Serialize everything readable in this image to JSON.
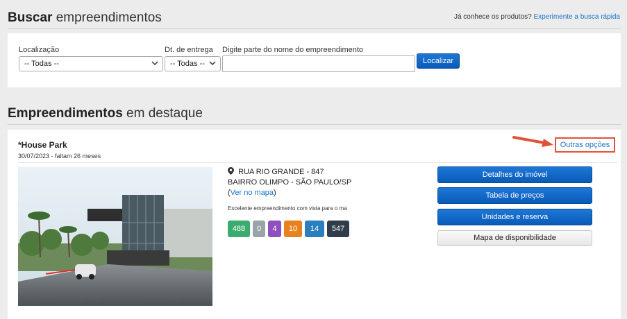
{
  "search": {
    "title_bold": "Buscar",
    "title_rest": "empreendimentos",
    "quick_prefix": "Já conhece os produtos?",
    "quick_link": "Experimente a busca rápida",
    "location_label": "Localização",
    "location_value": "-- Todas --",
    "delivery_label": "Dt. de entrega",
    "delivery_value": "-- Todas --",
    "name_label": "Digite parte do nome do empreendimento",
    "name_value": "",
    "submit_label": "Localizar"
  },
  "featured": {
    "title_bold": "Empreendimentos",
    "title_rest": "em destaque",
    "card": {
      "name": "*House Park",
      "date_line": "30/07/2023 - faltam 26 meses",
      "more_options": "Outras opções",
      "address_line1": "RUA RIO GRANDE - 847",
      "address_line2": "BAIRRO OLIMPO - SÃO PAULO/SP",
      "map_open": "(",
      "map_link": "Ver no mapa",
      "map_close": ")",
      "description": "Excelente empreendimento com vista para o ma",
      "badges": [
        {
          "value": "488",
          "color": "#3bab6f"
        },
        {
          "value": "0",
          "color": "#9aa3a8"
        },
        {
          "value": "4",
          "color": "#8e4fbf"
        },
        {
          "value": "10",
          "color": "#e8821e"
        },
        {
          "value": "14",
          "color": "#2a7fc0"
        },
        {
          "value": "547",
          "color": "#2f3d4a"
        }
      ],
      "buttons": {
        "details": "Detalhes do imóvel",
        "prices": "Tabela de preços",
        "units": "Unidades e reserva",
        "availability": "Mapa de disponibilidade"
      }
    }
  },
  "colors": {
    "accent_blue": "#0a5bb8",
    "link_blue": "#1a73c8",
    "highlight_red": "#e0533a"
  }
}
